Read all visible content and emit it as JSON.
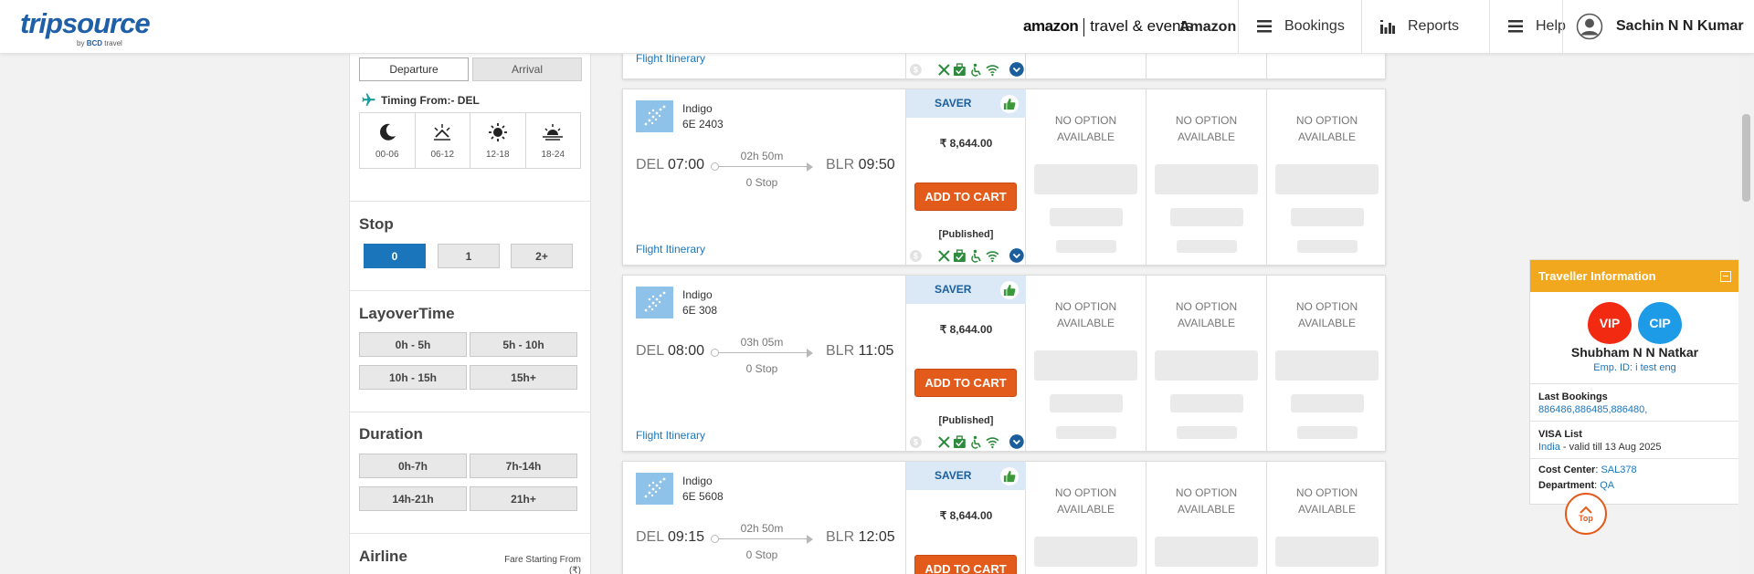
{
  "header": {
    "logo": "tripsource",
    "logo_sub_prefix": "by",
    "logo_sub_brand": "BCD",
    "logo_sub_suffix": "travel",
    "amazon_mark": "amazon",
    "amazon_tagline": "travel & events",
    "company": "Amazon",
    "nav": [
      {
        "label": "Bookings",
        "icon": "menu-icon"
      },
      {
        "label": "Reports",
        "icon": "bar-chart-icon"
      },
      {
        "label": "Help",
        "icon": "menu-icon"
      }
    ],
    "user_name": "Sachin N N Kumar"
  },
  "sidebar": {
    "tabs": [
      "Departure",
      "Arrival"
    ],
    "timing_label": "Timing From:- DEL",
    "timing_slots": [
      {
        "label": "00-06",
        "icon": "moon-icon"
      },
      {
        "label": "06-12",
        "icon": "sunrise-icon"
      },
      {
        "label": "12-18",
        "icon": "sun-icon"
      },
      {
        "label": "18-24",
        "icon": "sunset-icon"
      }
    ],
    "stop": {
      "title": "Stop",
      "options": [
        "0",
        "1",
        "2+"
      ],
      "selected": "0"
    },
    "layover": {
      "title": "LayoverTime",
      "options": [
        "0h - 5h",
        "5h - 10h",
        "10h - 15h",
        "15h+"
      ]
    },
    "duration": {
      "title": "Duration",
      "options": [
        "0h-7h",
        "7h-14h",
        "14h-21h",
        "21h+"
      ]
    },
    "airline": {
      "title": "Airline",
      "fare_from": "Fare Starting From",
      "fare_symbol": "(₹)"
    }
  },
  "results": {
    "itinerary_link": "Flight Itinerary",
    "add_to_cart": "ADD TO CART",
    "fare_type": "SAVER",
    "no_option": "NO OPTION AVAILABLE",
    "flights": [
      {
        "airline": "Indigo",
        "flight_no": "6E  2403",
        "from": "DEL",
        "dep_time": "07:00",
        "to": "BLR",
        "arr_time": "09:50",
        "duration": "02h 50m",
        "stops": "0 Stop",
        "price": "₹  8,644.00",
        "fare_source": "[Published]"
      },
      {
        "airline": "Indigo",
        "flight_no": "6E  308",
        "from": "DEL",
        "dep_time": "08:00",
        "to": "BLR",
        "arr_time": "11:05",
        "duration": "03h 05m",
        "stops": "0 Stop",
        "price": "₹  8,644.00",
        "fare_source": "[Published]"
      },
      {
        "airline": "Indigo",
        "flight_no": "6E  5608",
        "from": "DEL",
        "dep_time": "09:15",
        "to": "BLR",
        "arr_time": "12:05",
        "duration": "02h 50m",
        "stops": "0 Stop",
        "price": "₹  8,644.00",
        "fare_source": ""
      }
    ]
  },
  "traveller": {
    "title": "Traveller Information",
    "tags": [
      "VIP",
      "CIP"
    ],
    "name": "Shubham N N Natkar",
    "emp_id": "Emp. ID: i test eng",
    "last_bookings_label": "Last Bookings",
    "last_bookings": "886486,886485,886480,",
    "visa_label": "VISA List",
    "visa_country": "India",
    "visa_validity": " - valid till 13 Aug 2025",
    "cost_center_label": "Cost Center",
    "cost_center": "SAL378",
    "department_label": "Department",
    "department": "QA"
  },
  "top_button": "Top",
  "colors": {
    "brand_blue": "#1b75bb",
    "cart_orange": "#e35b1b",
    "panel_gold": "#f1a81e",
    "saver_bg": "#dbe9f6",
    "vip_red": "#f22a12",
    "cip_blue": "#1e9be6"
  }
}
